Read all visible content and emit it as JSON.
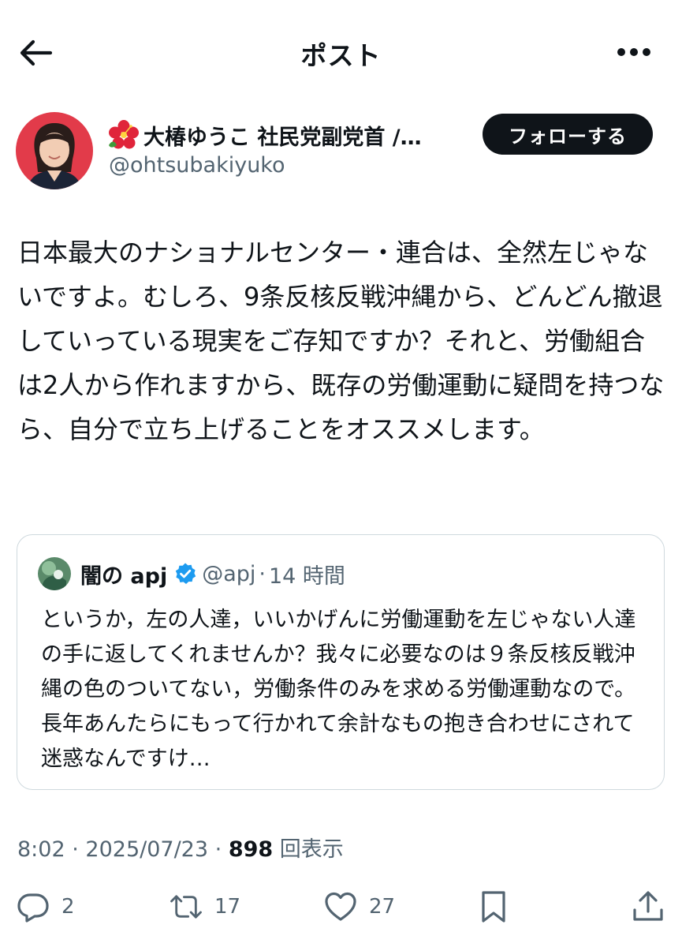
{
  "header": {
    "title": "ポスト"
  },
  "author": {
    "name": "大椿ゆうこ 社民党副党首 /…",
    "handle": "@ohtsubakiyuko",
    "follow_label": "フォローする"
  },
  "post": {
    "text": "日本最大のナショナルセンター・連合は、全然左じゃないですよ。むしろ、9条反核反戦沖縄から、どんどん撤退していっている現実をご存知ですか？それと、労働組合は2人から作れますから、既存の労働運動に疑問を持つなら、自分で立ち上げることをオススメします。"
  },
  "quote": {
    "name": "闇の apj",
    "handle": "@apj",
    "dot": "·",
    "time": "14 時間",
    "text": "というか，左の人達，いいかげんに労働運動を左じゃない人達の手に返してくれませんか？我々に必要なのは９条反核反戦沖縄の色のついてない，労働条件のみを求める労働運動なので。長年あんたらにもって行かれて余計なもの抱き合わせにされて迷惑なんですけ…"
  },
  "meta": {
    "time": "8:02",
    "sep1": "·",
    "date": "2025/07/23",
    "sep2": "·",
    "views_count": "898",
    "views_label": "回表示"
  },
  "actions": {
    "reply_count": "2",
    "repost_count": "17",
    "like_count": "27"
  },
  "colors": {
    "text": "#0f1419",
    "secondary": "#536471",
    "border": "#cfd9de",
    "verified": "#1d9bf0",
    "avatar_bg": "#e23b4a"
  },
  "icons": [
    "back-arrow-icon",
    "more-icon",
    "flower-icon",
    "verified-icon",
    "reply-icon",
    "repost-icon",
    "like-icon",
    "bookmark-icon",
    "share-icon"
  ]
}
